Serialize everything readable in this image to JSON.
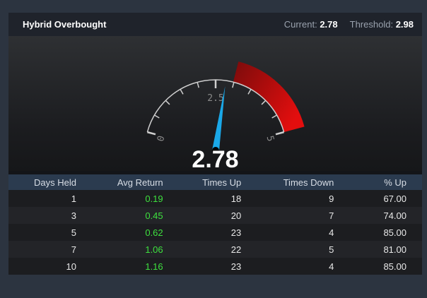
{
  "header": {
    "title": "Hybrid Overbought",
    "current_label": "Current:",
    "current_value": "2.78",
    "threshold_label": "Threshold:",
    "threshold_value": "2.98"
  },
  "gauge": {
    "min": 0,
    "max": 5,
    "value": 2.78,
    "value_display": "2.78",
    "threshold": 2.98,
    "labels": [
      "0",
      "2.5",
      "5"
    ],
    "colors": {
      "needle": "#1aa8e8",
      "band_start": "#7a0b0b",
      "band_end": "#e30e0e",
      "ticks": "#cfcfcf"
    }
  },
  "table": {
    "columns": [
      "Days Held",
      "Avg Return",
      "Times Up",
      "Times Down",
      "% Up"
    ],
    "rows": [
      [
        "1",
        "0.19",
        "18",
        "9",
        "67.00"
      ],
      [
        "3",
        "0.45",
        "20",
        "7",
        "74.00"
      ],
      [
        "5",
        "0.62",
        "23",
        "4",
        "85.00"
      ],
      [
        "7",
        "1.06",
        "22",
        "5",
        "81.00"
      ],
      [
        "10",
        "1.16",
        "23",
        "4",
        "85.00"
      ]
    ],
    "return_color": "#3ee03e"
  }
}
